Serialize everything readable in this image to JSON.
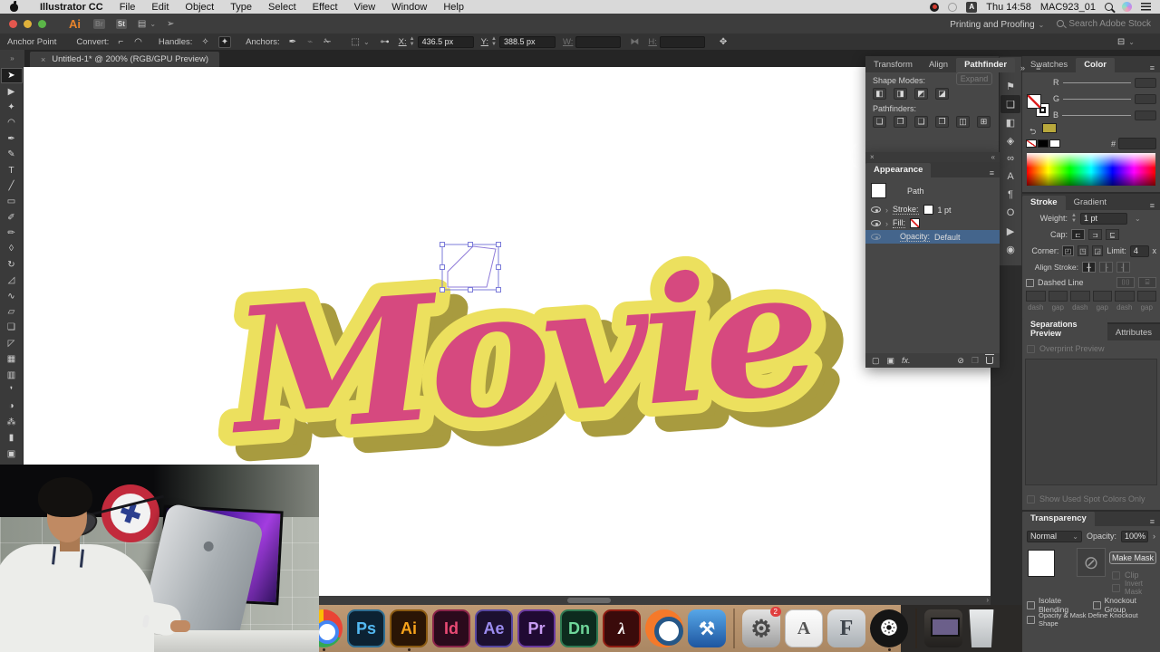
{
  "menu_bar": {
    "items": [
      "Illustrator CC",
      "File",
      "Edit",
      "Object",
      "Type",
      "Select",
      "Effect",
      "View",
      "Window",
      "Help"
    ],
    "status": {
      "input_source": "A",
      "time": "Thu 14:58",
      "host": "MAC923_01"
    }
  },
  "app_bar": {
    "logo": "Ai",
    "bridge": "Br",
    "stock_badge": "St",
    "workspace": "Printing and Proofing",
    "stock_search": "Search Adobe Stock"
  },
  "control_bar": {
    "mode_label": "Anchor Point",
    "convert_label": "Convert:",
    "handles_label": "Handles:",
    "anchors_label": "Anchors:",
    "x_label": "X:",
    "x_value": "436.5 px",
    "y_label": "Y:",
    "y_value": "388.5 px",
    "w_label": "W:",
    "h_label": "H:"
  },
  "document_tab": {
    "close": "×",
    "title": "Untitled-1* @ 200% (RGB/GPU Preview)"
  },
  "toolbar": {
    "tools": [
      {
        "name": "selection",
        "glyph": "➤",
        "sel": true
      },
      {
        "name": "direct-selection",
        "glyph": "▶"
      },
      {
        "name": "magic-wand",
        "glyph": "✦"
      },
      {
        "name": "lasso",
        "glyph": "◠"
      },
      {
        "name": "pen",
        "glyph": "✒"
      },
      {
        "name": "curvature",
        "glyph": "✎"
      },
      {
        "name": "type",
        "glyph": "T"
      },
      {
        "name": "line-segment",
        "glyph": "╱"
      },
      {
        "name": "rectangle",
        "glyph": "▭"
      },
      {
        "name": "paintbrush",
        "glyph": "✐"
      },
      {
        "name": "shaper",
        "glyph": "✏"
      },
      {
        "name": "eraser",
        "glyph": "◊"
      },
      {
        "name": "rotate",
        "glyph": "↻"
      },
      {
        "name": "scale",
        "glyph": "◿"
      },
      {
        "name": "width",
        "glyph": "∿"
      },
      {
        "name": "free-transform",
        "glyph": "▱"
      },
      {
        "name": "shape-builder",
        "glyph": "❑"
      },
      {
        "name": "perspective-grid",
        "glyph": "◸"
      },
      {
        "name": "mesh",
        "glyph": "▦"
      },
      {
        "name": "gradient",
        "glyph": "▥"
      },
      {
        "name": "eyedropper",
        "glyph": "❜"
      },
      {
        "name": "blend",
        "glyph": "◑"
      },
      {
        "name": "symbol-sprayer",
        "glyph": "⁂"
      },
      {
        "name": "column-graph",
        "glyph": "▮"
      },
      {
        "name": "artboard",
        "glyph": "▣"
      },
      {
        "name": "slice",
        "glyph": "✂"
      },
      {
        "name": "hand",
        "glyph": "✥"
      },
      {
        "name": "zoom",
        "glyph": "⊙"
      }
    ]
  },
  "artwork": {
    "text": "Movie",
    "fill": "#d6497f",
    "outline": "#ece05e",
    "shadow": "#a89b3f"
  },
  "right_dock": {
    "icons": [
      {
        "name": "transform-panel",
        "glyph": "⊞"
      },
      {
        "name": "align-panel",
        "glyph": "⚑"
      },
      {
        "name": "pathfinder-panel",
        "glyph": "❑",
        "sel": true
      },
      {
        "name": "shape-builder-panel",
        "glyph": "◧"
      },
      {
        "name": "layers-panel",
        "glyph": "◈"
      },
      {
        "name": "links-panel",
        "glyph": "∞"
      },
      {
        "name": "character-panel",
        "glyph": "A"
      },
      {
        "name": "paragraph-panel",
        "glyph": "¶"
      },
      {
        "name": "glyphs-panel",
        "glyph": "O"
      },
      {
        "name": "actions-panel",
        "glyph": "▶"
      },
      {
        "name": "cc-libraries-panel",
        "glyph": "◉"
      }
    ]
  },
  "panels": {
    "pathfinder": {
      "tabs": [
        "Transform",
        "Align",
        "Pathfinder"
      ],
      "overflow": "»",
      "menu": "≡",
      "shape_modes_label": "Shape Modes:",
      "expand_label": "Expand",
      "pathfinders_label": "Pathfinders:",
      "shape_mode_icons": [
        {
          "name": "unite",
          "glyph": "◧"
        },
        {
          "name": "minus-front",
          "glyph": "◨"
        },
        {
          "name": "intersect",
          "glyph": "◩"
        },
        {
          "name": "exclude",
          "glyph": "◪"
        }
      ],
      "pathfinder_icons": [
        {
          "name": "divide",
          "glyph": "❏"
        },
        {
          "name": "trim",
          "glyph": "❐"
        },
        {
          "name": "merge",
          "glyph": "❑"
        },
        {
          "name": "crop",
          "glyph": "❒"
        },
        {
          "name": "outline",
          "glyph": "◫"
        },
        {
          "name": "minus-back",
          "glyph": "⊞"
        }
      ]
    },
    "appearance": {
      "close": "×",
      "collapse": "«",
      "title": "Appearance",
      "menu": "≡",
      "path_label": "Path",
      "stroke_label": "Stroke:",
      "stroke_value": "1 pt",
      "fill_label": "Fill:",
      "opacity_label": "Opacity:",
      "opacity_value": "Default",
      "fx_label": "fx."
    },
    "color": {
      "tabs": [
        "Swatches",
        "Color"
      ],
      "menu": "≡",
      "channels": [
        {
          "label": "R"
        },
        {
          "label": "G"
        },
        {
          "label": "B"
        }
      ],
      "hex_label": "#",
      "last_color": "#b8a83c"
    },
    "stroke": {
      "tab_active": "Stroke",
      "tab2": "Gradient",
      "menu": "≡",
      "weight_label": "Weight:",
      "weight_value": "1 pt",
      "cap_label": "Cap:",
      "corner_label": "Corner:",
      "limit_label": "Limit:",
      "limit_value": "4",
      "limit_suffix": "x",
      "align_label": "Align Stroke:",
      "dashed_label": "Dashed Line",
      "dash_labels": [
        "dash",
        "gap",
        "dash",
        "gap",
        "dash",
        "gap"
      ]
    },
    "separations": {
      "tabs": [
        "Separations Preview",
        "Attributes"
      ],
      "overprint_label": "Overprint Preview",
      "spot_colors_label": "Show Used Spot Colors Only"
    },
    "transparency": {
      "title": "Transparency",
      "menu": "≡",
      "blend_mode": "Normal",
      "opacity_label": "Opacity:",
      "opacity_value": "100%",
      "make_mask_label": "Make Mask",
      "clip_label": "Clip",
      "invert_label": "Invert Mask",
      "isolate_label": "Isolate Blending",
      "knockout_label": "Knockout Group",
      "knockout_shape_label": "Opacity & Mask Define Knockout Shape"
    }
  },
  "dock": {
    "items": [
      {
        "name": "chrome",
        "label": "",
        "cls": "tile chrome",
        "dot": true
      },
      {
        "name": "photoshop",
        "label": "Ps",
        "cls": "tile adobe",
        "style": "background:#0c2233;color:#53b9f2;border:2px solid #2f6e91"
      },
      {
        "name": "illustrator",
        "label": "Ai",
        "cls": "tile adobe",
        "style": "background:#2a1505;color:#f7a31b;border:2px solid #8a5a12",
        "dot": true
      },
      {
        "name": "indesign",
        "label": "Id",
        "cls": "tile adobe",
        "style": "background:#2b0a1c;color:#e94a74;border:2px solid #8a2449"
      },
      {
        "name": "after-effects",
        "label": "Ae",
        "cls": "tile adobe",
        "style": "background:#1c1030;color:#9b8cf0;border:2px solid #5747a0"
      },
      {
        "name": "premiere",
        "label": "Pr",
        "cls": "tile adobe",
        "style": "background:#200a33;color:#c79bf2;border:2px solid #6a3a9e"
      },
      {
        "name": "dimension",
        "label": "Dn",
        "cls": "tile adobe",
        "style": "background:#0d2b1e;color:#6fd79a;border:2px solid #2f7a52"
      },
      {
        "name": "acrobat",
        "label": "λ",
        "cls": "tile adobe acrobat",
        "style": "background:#3a0b0b;color:#ffffff;border:2px solid #8f1d12"
      },
      {
        "name": "blender",
        "label": "",
        "cls": "tile blender"
      },
      {
        "name": "xcode",
        "label": "⚒",
        "cls": "tile xcode"
      },
      {
        "name": "separator-1",
        "label": "",
        "cls": "sep"
      },
      {
        "name": "system-preferences",
        "label": "⚙",
        "cls": "tile gear",
        "badge": "2"
      },
      {
        "name": "textedit",
        "label": "A",
        "cls": "tile textedit"
      },
      {
        "name": "font-book",
        "label": "F",
        "cls": "tile fontbook"
      },
      {
        "name": "obs",
        "label": "❂",
        "cls": "tile obs",
        "dot": true
      },
      {
        "name": "separator-2",
        "label": "",
        "cls": "sep"
      },
      {
        "name": "screen-share",
        "label": "",
        "cls": "tile display"
      },
      {
        "name": "trash",
        "label": "",
        "cls": "tile trash"
      }
    ]
  }
}
